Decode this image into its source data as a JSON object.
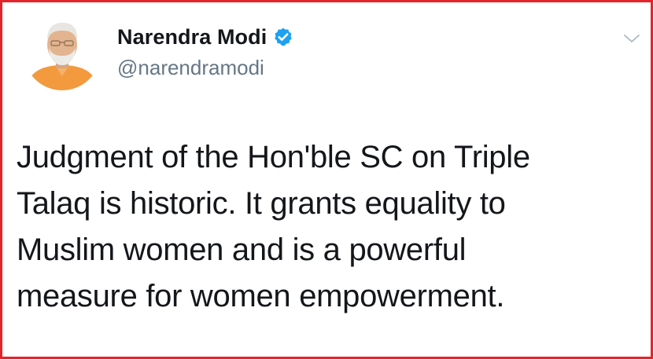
{
  "tweet": {
    "author": {
      "display_name": "Narendra Modi",
      "handle": "@narendramodi",
      "verified": true,
      "avatar_icon": "profile-photo"
    },
    "menu_icon": "chevron-down-icon",
    "text_lines": [
      "Judgment of the Hon'ble SC on Triple",
      "Talaq is historic. It grants equality to",
      "Muslim women and is a powerful",
      "measure for women empowerment."
    ]
  },
  "colors": {
    "frame_border": "#e3242b",
    "verified_badge": "#1da1f2",
    "handle_text": "#657786",
    "body_text": "#14171a",
    "avatar_saffron": "#f39a3e"
  }
}
